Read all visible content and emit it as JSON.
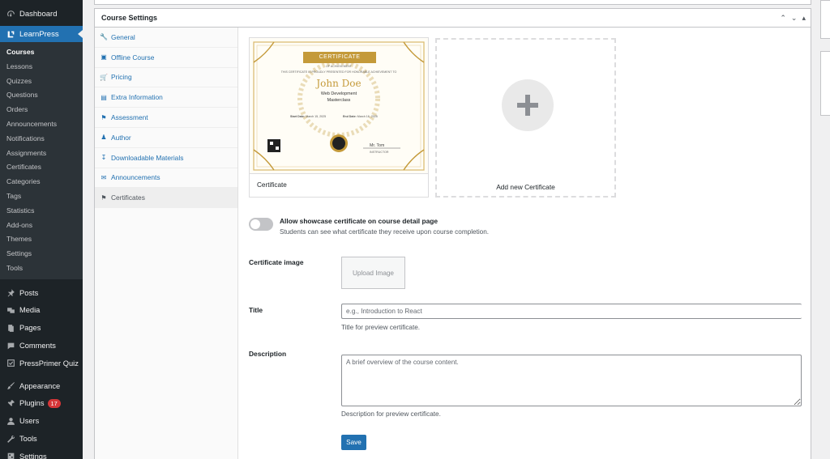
{
  "sidebar": {
    "top_items": [
      {
        "label": "Dashboard",
        "icon": "dashboard-icon"
      },
      {
        "label": "LearnPress",
        "icon": "learnpress-icon"
      }
    ],
    "learnpress_submenu": [
      "Courses",
      "Lessons",
      "Quizzes",
      "Questions",
      "Orders",
      "Announcements",
      "Notifications",
      "Assignments",
      "Certificates",
      "Categories",
      "Tags",
      "Statistics",
      "Add-ons",
      "Themes",
      "Settings",
      "Tools"
    ],
    "lower_items": [
      {
        "label": "Posts",
        "icon": "pin-icon"
      },
      {
        "label": "Media",
        "icon": "media-icon"
      },
      {
        "label": "Pages",
        "icon": "pages-icon"
      },
      {
        "label": "Comments",
        "icon": "comments-icon"
      },
      {
        "label": "PressPrimer Quiz",
        "icon": "quiz-icon"
      },
      {
        "label": "Appearance",
        "icon": "brush-icon"
      },
      {
        "label": "Plugins",
        "icon": "plugin-icon",
        "badge": "17"
      },
      {
        "label": "Users",
        "icon": "users-icon"
      },
      {
        "label": "Tools",
        "icon": "wrench-icon"
      },
      {
        "label": "Settings",
        "icon": "settings-icon"
      }
    ]
  },
  "metabox": {
    "title": "Course Settings",
    "tabs": [
      {
        "label": "General",
        "icon": "wrench-icon"
      },
      {
        "label": "Offline Course",
        "icon": "monitor-icon"
      },
      {
        "label": "Pricing",
        "icon": "cart-icon"
      },
      {
        "label": "Extra Information",
        "icon": "info-list-icon"
      },
      {
        "label": "Assessment",
        "icon": "assessment-icon"
      },
      {
        "label": "Author",
        "icon": "author-icon"
      },
      {
        "label": "Downloadable Materials",
        "icon": "download-icon"
      },
      {
        "label": "Announcements",
        "icon": "megaphone-icon"
      },
      {
        "label": "Certificates",
        "icon": "flag-icon"
      }
    ]
  },
  "certificate": {
    "card_label": "Certificate",
    "preview": {
      "heading": "CERTIFICATE",
      "subheading": "OF ACHIEVEMENT",
      "presented_line": "THIS CERTIFICATE IS PROUDLY PRESENTED FOR HONORABLE ACHIEVEMENT TO",
      "recipient": "John Doe",
      "course_line1": "Web Development",
      "course_line2": "Masterclass",
      "start_date_label": "Start Date:",
      "start_date": "March 15, 2025",
      "end_date_label": "End Date:",
      "end_date": "March 16, 2025",
      "instructor": "Mr. Tom",
      "instructor_role": "INSTRUCTOR"
    },
    "add_label": "Add new Certificate"
  },
  "form": {
    "showcase_label": "Allow showcase certificate on course detail page",
    "showcase_desc": "Students can see what certificate they receive upon course completion.",
    "image_label": "Certificate image",
    "upload_label": "Upload Image",
    "title_label": "Title",
    "title_placeholder": "e.g., Introduction to React",
    "title_desc": "Title for preview certificate.",
    "description_label": "Description",
    "description_placeholder": "A brief overview of the course content.",
    "description_desc": "Description for preview certificate.",
    "save_label": "Save"
  },
  "colors": {
    "admin_bar": "#1d2327",
    "accent": "#2271b1",
    "gold": "#c49a3a",
    "badge": "#d63638"
  }
}
